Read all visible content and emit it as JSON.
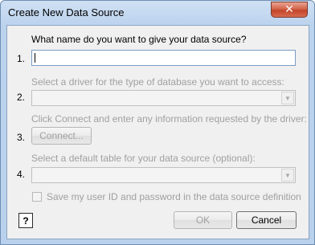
{
  "window": {
    "title": "Create New Data Source",
    "close_glyph": "✕"
  },
  "steps": [
    {
      "number": "1.",
      "prompt": "What name do you want to give your data source?",
      "value": ""
    },
    {
      "number": "2.",
      "prompt": "Select a driver for the type of database you want to access:"
    },
    {
      "number": "3.",
      "prompt": "Click Connect and enter any information requested by the driver:",
      "button_label": "Connect..."
    },
    {
      "number": "4.",
      "prompt": "Select a default table for your data source (optional):"
    }
  ],
  "save_credentials": {
    "label": "Save my user ID and password in the data source definition",
    "checked": false
  },
  "footer": {
    "help_label": "?",
    "ok_label": "OK",
    "cancel_label": "Cancel"
  },
  "colors": {
    "title_bar": "#bcd3ee",
    "client_bg": "#f0f0f0",
    "disabled_text": "#a0a0a0",
    "close_button": "#c4452a"
  },
  "icons": {
    "close": "close-icon",
    "combo_arrow": "chevron-down-icon",
    "help": "help-icon"
  }
}
